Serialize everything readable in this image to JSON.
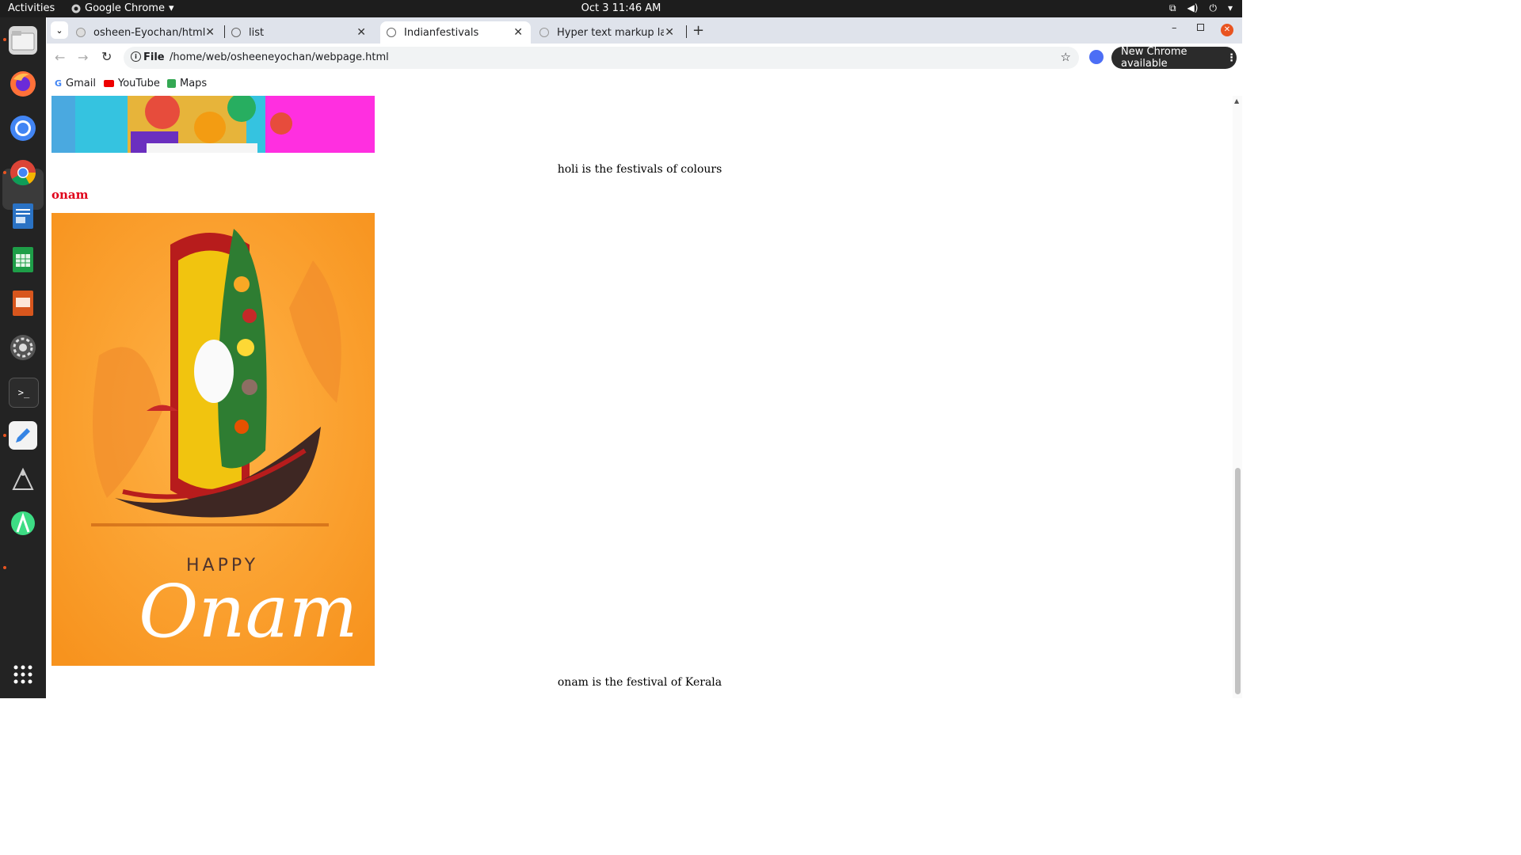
{
  "system": {
    "activities": "Activities",
    "app_name": "Google Chrome",
    "clock": "Oct 3  11:46 AM"
  },
  "browser": {
    "tabs": [
      {
        "label": "osheen-Eyochan/html"
      },
      {
        "label": "list"
      },
      {
        "label": "Indianfestivals"
      },
      {
        "label": "Hyper text markup langu"
      }
    ],
    "address": {
      "scheme_label": "File",
      "url": "/home/web/osheeneyochan/webpage.html"
    },
    "update_button": "New Chrome available",
    "bookmarks": [
      "Gmail",
      "YouTube",
      "Maps"
    ]
  },
  "page": {
    "holi_caption": "holi is the festivals of colours",
    "onam_heading": "onam",
    "onam_banner": {
      "word1": "HAPPY",
      "word2": "Onam"
    },
    "onam_caption": "onam is the festival of Kerala"
  },
  "colors": {
    "heading": "#e0001a",
    "onam_bg": "#f7931e",
    "accent": "#e95420"
  }
}
